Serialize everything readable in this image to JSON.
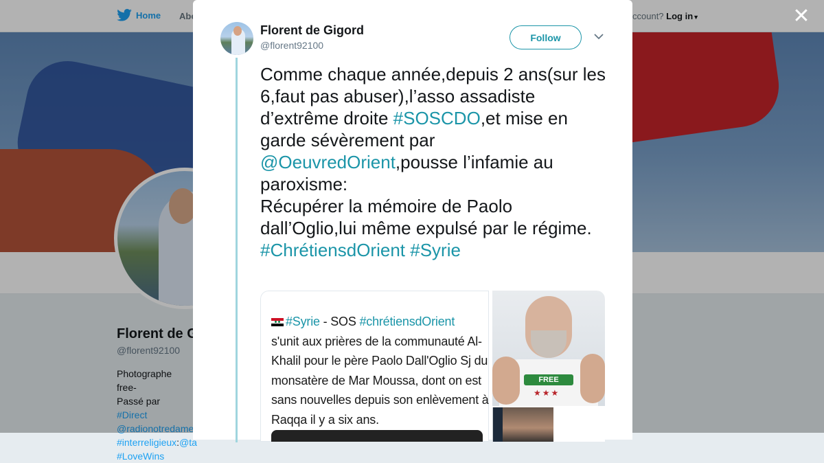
{
  "topbar": {
    "home_label": "Home",
    "about_label": "Abo",
    "account_prompt": "ccount?",
    "login_label": "Log in"
  },
  "profile": {
    "name": "Florent de G",
    "handle": "@florent92100",
    "bio_lines": [
      "Photographe free-",
      "Passé par ",
      "#Direct",
      "@radionotredame",
      "#interreligieux",
      ":",
      "@ta",
      "#LoveWins"
    ]
  },
  "tweet": {
    "author_name": "Florent de Gigord",
    "author_handle": "@florent92100",
    "follow_label": "Follow",
    "text_parts": [
      "Comme chaque année,depuis 2 ans(sur les 6,faut pas abuser),l’asso assadiste d’extrême droite ",
      "#SOSCDO",
      ",et mise en garde sévèrement par ",
      "@OeuvredOrient",
      ",pousse l’infamie au paroxisme:\nRécupérer la mémoire de Paolo dall’Oglio,lui même expulsé par le régime.\n",
      "#ChrétiensdOrient",
      " ",
      "#Syrie"
    ],
    "image_text": {
      "hashtag_syrie": "#Syrie",
      "dash": " - SOS ",
      "hashtag_chretiens": "#chrétiensdOrient",
      "body": "s'unit aux prières de la communauté Al-Khalil pour le père Paolo Dall'Oglio Sj du  monsatère de Mar Moussa, dont on est sans nouvelles depuis son enlèvement à Raqqa il y a six ans."
    },
    "shirt_text": "FREE",
    "shirt_stars": "★★★"
  },
  "icons": {
    "close": "close-icon",
    "caret": "chevron-down-icon",
    "twitter": "twitter-bird-icon"
  },
  "colors": {
    "link": "#1b95a8",
    "twitter_blue": "#1da1f2",
    "thread_line": "#9fd5de"
  }
}
